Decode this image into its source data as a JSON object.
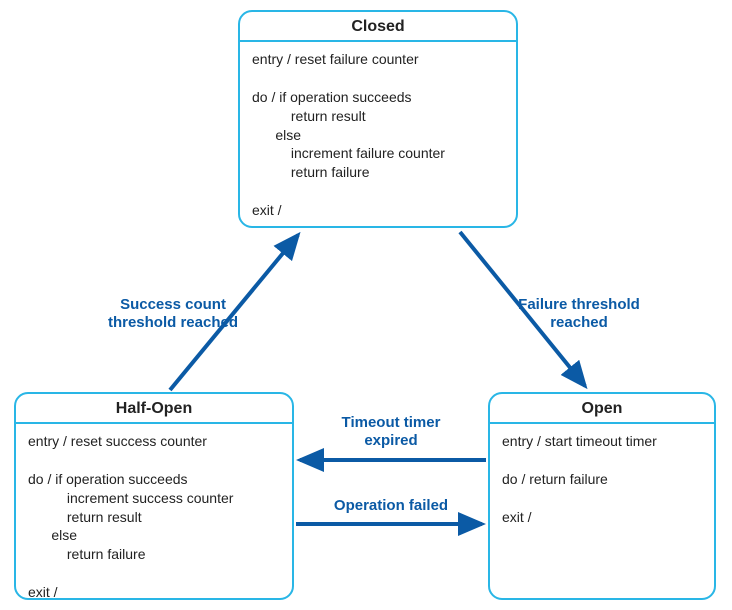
{
  "states": {
    "closed": {
      "title": "Closed",
      "body": "entry / reset failure counter\n\ndo / if operation succeeds\n          return result\n      else\n          increment failure counter\n          return failure\n\nexit /"
    },
    "halfopen": {
      "title": "Half-Open",
      "body": "entry / reset success counter\n\ndo / if operation succeeds\n          increment success counter\n          return result\n      else\n          return failure\n\nexit /"
    },
    "open": {
      "title": "Open",
      "body": "entry / start timeout timer\n\ndo / return failure\n\nexit /"
    }
  },
  "transitions": {
    "success_threshold": "Success count\nthreshold reached",
    "failure_threshold": "Failure threshold\nreached",
    "timeout_expired": "Timeout timer\nexpired",
    "operation_failed": "Operation failed"
  },
  "colors": {
    "border": "#29b6e6",
    "arrow": "#0b5aa5",
    "label": "#0b5aa5"
  }
}
